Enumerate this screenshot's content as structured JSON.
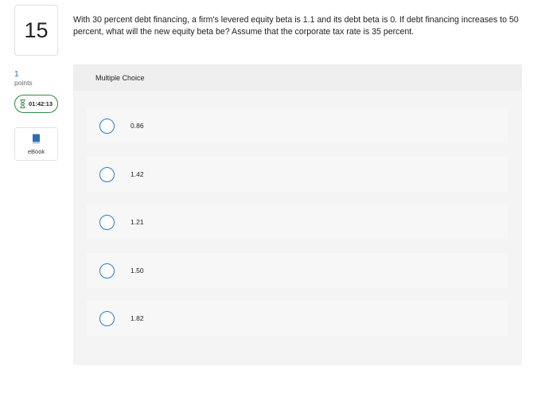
{
  "question": {
    "number": "15",
    "text": "With 30 percent debt financing, a firm's levered equity beta is 1.1 and its debt beta is 0. If debt financing increases to 50 percent, what will the new equity beta be? Assume that the corporate tax rate is 35 percent."
  },
  "sidebar": {
    "points_value": "1",
    "points_label": "points",
    "timer": "01:42:13",
    "timer_icon": "hourglass-icon",
    "ebook_label": "eBook",
    "ebook_icon": "book-icon"
  },
  "multiple_choice": {
    "title": "Multiple Choice",
    "options": [
      {
        "label": "0.86"
      },
      {
        "label": "1.42"
      },
      {
        "label": "1.21"
      },
      {
        "label": "1.50"
      },
      {
        "label": "1.82"
      }
    ]
  },
  "colors": {
    "accent": "#2a7bbd",
    "timer_border": "#2f8a45",
    "ebook_icon": "#2f6db3"
  }
}
